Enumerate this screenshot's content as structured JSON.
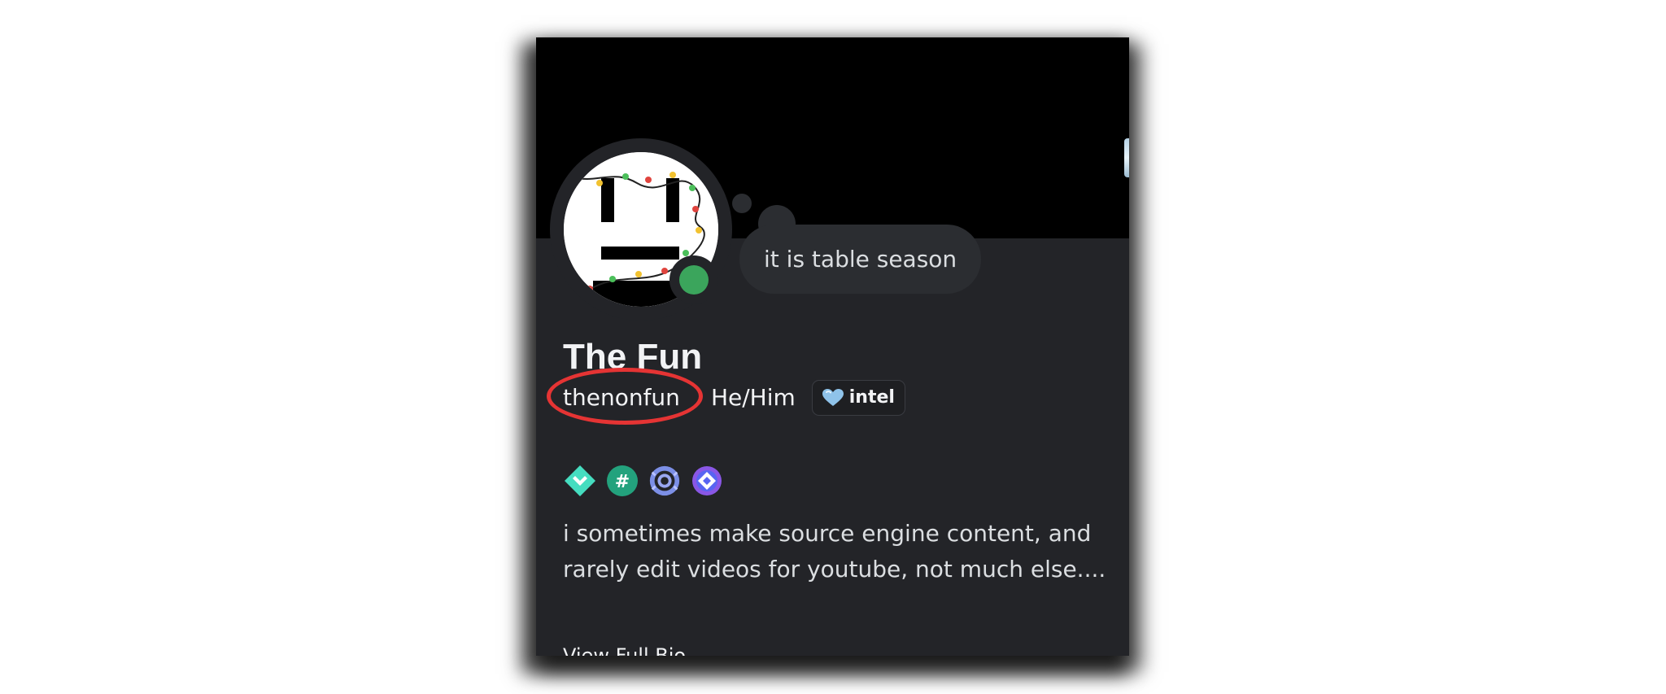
{
  "profile": {
    "display_name": "The Fun",
    "username": "thenonfun",
    "pronouns": "He/Him",
    "custom_status": "it is table season",
    "status": "online",
    "clan_tag": "intel",
    "bio": "i sometimes make source engine content, and rarely edit videos for youtube, not much else....",
    "view_full_bio_label": "View Full Bio"
  },
  "badges": [
    {
      "icon": "hypesquad-balance-icon"
    },
    {
      "icon": "hashtag-badge-icon"
    },
    {
      "icon": "nitro-laurel-badge-icon"
    },
    {
      "icon": "quest-badge-icon"
    }
  ],
  "colors": {
    "card_background": "#232428",
    "banner": "#000000",
    "online_status": "#3ba55c",
    "highlight_annotation": "#e53434",
    "text_primary": "#f2f3f5"
  }
}
